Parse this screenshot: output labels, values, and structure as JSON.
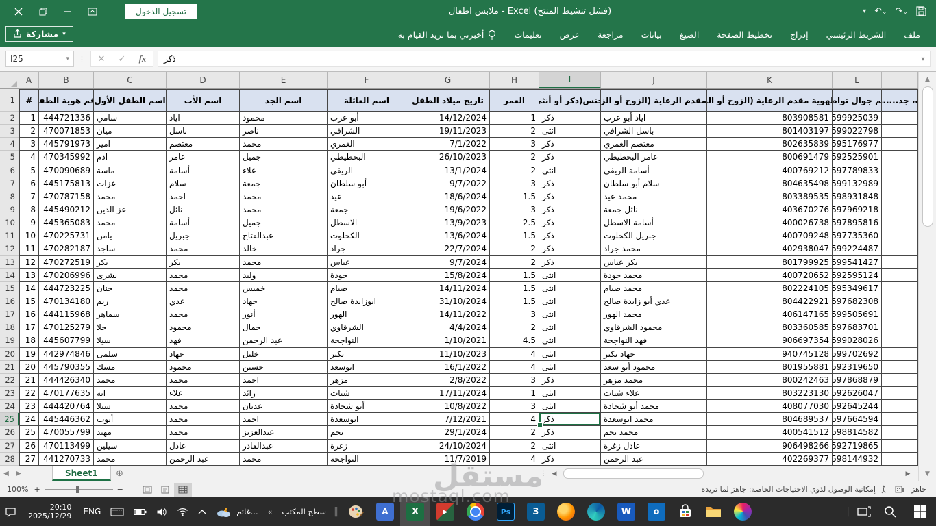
{
  "titlebar": {
    "title": "ملابس اطفال  -  Excel (فشل تنشيط المنتج)",
    "sign_in_label": "تسجيل الدخول"
  },
  "ribbon": {
    "share_label": "مشاركة",
    "tabs": [
      "ملف",
      "الشريط الرئيسي",
      "إدراج",
      "تخطيط الصفحة",
      "الصيغ",
      "بيانات",
      "مراجعة",
      "عرض",
      "تعليمات"
    ],
    "tell_me_label": "أخبرني بما تريد القيام به"
  },
  "formula_bar": {
    "name_box": "I25",
    "value": "ذكر"
  },
  "grid": {
    "column_letters": [
      "A",
      "B",
      "C",
      "D",
      "E",
      "F",
      "G",
      "H",
      "I",
      "J",
      "K",
      "L",
      ""
    ],
    "selected_cell": "I25",
    "selected_row": 25,
    "selected_col_index": 8,
    "headers": [
      "#",
      "رقم هوية الطفل",
      "اسم الطفل الأول",
      "اسم الأب",
      "اسم الجد",
      "اسم العائلة",
      "تاريخ ميلاد الطفل",
      "العمر",
      "الجنس(ذكر أو أنثى)",
      "اسم مقدم الرعاية (الزوج أو الزوجة)",
      "رقم الهوية مقدم الرعاية (الزوج أو الزوجة)",
      "رقم جوال تواصل",
      "ب، جد......)"
    ],
    "rows": [
      [
        "1",
        "444721336",
        "سامي",
        "اياد",
        "محمود",
        "أبو عرب",
        "14/12/2024",
        "1",
        "ذكر",
        "اياد أبو عرب",
        "803908581",
        "599925039"
      ],
      [
        "2",
        "470071853",
        "ميان",
        "باسل",
        "ناصر",
        "الشرافي",
        "19/11/2023",
        "2",
        "انثى",
        "باسل الشرافي",
        "801403197",
        "599022798"
      ],
      [
        "3",
        "445791973",
        "امير",
        "معتصم",
        "محمد",
        "الغمري",
        "7/1/2022",
        "3",
        "ذكر",
        "معتصم الغمري",
        "802635839",
        "595176977"
      ],
      [
        "4",
        "470345992",
        "ادم",
        "عامر",
        "جميل",
        "البحطيطي",
        "26/10/2023",
        "2",
        "ذكر",
        "عامر البحطيطي",
        "800691479",
        "592525901"
      ],
      [
        "5",
        "470090689",
        "ماسة",
        "أسامة",
        "علاء",
        "الريفي",
        "13/1/2024",
        "2",
        "انثى",
        "أسامة الريفي",
        "400769212",
        "597789833"
      ],
      [
        "6",
        "445175813",
        "عزات",
        "سلام",
        "جمعة",
        "أبو سلطان",
        "9/7/2022",
        "3",
        "ذكر",
        "سلام أبو سلطان",
        "804635498",
        "599132989"
      ],
      [
        "7",
        "470787158",
        "محمد",
        "احمد",
        "محمد",
        "عيد",
        "18/6/2024",
        "1.5",
        "ذكر",
        "محمد عيد",
        "803389535",
        "598931848"
      ],
      [
        "8",
        "445490212",
        "عز الدين",
        "نائل",
        "محمد",
        "جمعة",
        "19/6/2022",
        "3",
        "ذكر",
        "نائل جمعة",
        "403670276",
        "597969218"
      ],
      [
        "9",
        "445365083",
        "محمد",
        "أسامة",
        "جميل",
        "الاسطل",
        "13/9/2023",
        "2.5",
        "ذكر",
        "أسامة الاسطل",
        "400026738",
        "597895816"
      ],
      [
        "10",
        "470225731",
        "يامن",
        "جبريل",
        "عبدالفتاح",
        "الكحلوت",
        "13/6/2024",
        "1.5",
        "ذكر",
        "جبريل الكحلوت",
        "400709248",
        "597735360"
      ],
      [
        "11",
        "470282187",
        "ساجد",
        "محمد",
        "خالد",
        "جراد",
        "22/7/2024",
        "2",
        "ذكر",
        "محمد جراد",
        "402938047",
        "599224487"
      ],
      [
        "12",
        "470272519",
        "بكر",
        "بكر",
        "محمد",
        "عباس",
        "9/7/2024",
        "2",
        "ذكر",
        "بكر عباس",
        "801799925",
        "599541427"
      ],
      [
        "13",
        "470206996",
        "بشرى",
        "محمد",
        "وليد",
        "جودة",
        "15/8/2024",
        "1.5",
        "انثى",
        "محمد جودة",
        "400720652",
        "592595124"
      ],
      [
        "14",
        "444723225",
        "حنان",
        "محمد",
        "خميس",
        "صيام",
        "14/11/2024",
        "1.5",
        "انثى",
        "محمد صيام",
        "802224105",
        "595349617"
      ],
      [
        "15",
        "470134180",
        "ريم",
        "عدي",
        "جهاد",
        "ابوزايدة صالح",
        "31/10/2024",
        "1.5",
        "انثى",
        "عدي أبو زايدة صالح",
        "804422921",
        "597682308"
      ],
      [
        "16",
        "444115968",
        "سماهر",
        "محمد",
        "أنور",
        "الهور",
        "14/11/2022",
        "3",
        "انثى",
        "محمد الهور",
        "406147165",
        "599505691"
      ],
      [
        "17",
        "470125279",
        "حلا",
        "محمود",
        "جمال",
        "الشرقاوي",
        "4/4/2024",
        "2",
        "انثى",
        "محمود الشرقاوي",
        "803360585",
        "597683701"
      ],
      [
        "18",
        "445607799",
        "سيلا",
        "فهد",
        "عبد الرحمن",
        "النواجحة",
        "1/10/2021",
        "4.5",
        "انثى",
        "فهد النواجحة",
        "906697354",
        "599028026"
      ],
      [
        "19",
        "442974846",
        "سلمى",
        "جهاد",
        "خليل",
        "بكير",
        "11/10/2023",
        "4",
        "انثى",
        "جهاد بكير",
        "940745128",
        "599702692"
      ],
      [
        "20",
        "445790355",
        "مسك",
        "محمود",
        "حسين",
        "ابوسعد",
        "16/1/2022",
        "4",
        "انثى",
        "محمود أبو سعد",
        "801955881",
        "592319650"
      ],
      [
        "21",
        "444426340",
        "محمد",
        "محمد",
        "احمد",
        "مزهر",
        "2/8/2022",
        "3",
        "ذكر",
        "محمد مزهر",
        "800242463",
        "597868879"
      ],
      [
        "22",
        "470177635",
        "اية",
        "علاء",
        "رائد",
        "شبات",
        "17/11/2024",
        "1",
        "انثى",
        "علاء شبات",
        "803223130",
        "592626047"
      ],
      [
        "23",
        "444420764",
        "سيلا",
        "محمد",
        "عدنان",
        "أبو شحادة",
        "10/8/2022",
        "3",
        "انثى",
        "محمد أبو شحادة",
        "408077030",
        "592645244"
      ],
      [
        "24",
        "445446362",
        "أيوب",
        "محمد",
        "احمد",
        "ابوسعدة",
        "7/12/2021",
        "4",
        "ذكر",
        "محمد ابوسعدة",
        "804689537",
        "597664594"
      ],
      [
        "25",
        "470055799",
        "مهند",
        "محمد",
        "عبدالعزيز",
        "نجم",
        "29/1/2024",
        "2",
        "ذكر",
        "محمد نجم",
        "400541512",
        "598814582"
      ],
      [
        "26",
        "470113499",
        "سيلين",
        "عادل",
        "عبدالقادر",
        "زغرة",
        "24/10/2024",
        "2",
        "انثى",
        "عادل زغرة",
        "906498266",
        "592719865"
      ],
      [
        "27",
        "441270733",
        "محمد",
        "عبد الرحمن",
        "محمد",
        "النواجحة",
        "11/7/2019",
        "4",
        "ذكر",
        "عبد الرحمن",
        "402269377",
        "598144932"
      ]
    ]
  },
  "sheet_bar": {
    "active_sheet": "Sheet1"
  },
  "status_bar": {
    "ready_label": "جاهز",
    "accessibility_label": "إمكانية الوصول لذوي الاحتياجات الخاصة: جاهز لما تريده",
    "zoom_level": "100%"
  },
  "taskbar": {
    "time": "20:10",
    "date": "2025/12/29",
    "language": "ENG",
    "weather_label": "غائم...",
    "desktop_toolbar_label": "سطح المكتب",
    "icons": [
      "notification-icon",
      "keyboard-icon",
      "battery-icon",
      "speaker-icon",
      "wifi-icon",
      "hidden-icons-chevron",
      "weather-icon",
      "paint-icon",
      "wordpad-icon",
      "excel-icon",
      "media-app-icon",
      "chrome-icon",
      "photoshop-icon",
      "3dsmax-icon",
      "firefox-icon",
      "edge-icon",
      "word-icon",
      "outlook-icon",
      "store-icon",
      "file-explorer-icon",
      "paint3d-icon",
      "task-view-icon",
      "search-icon",
      "start-icon"
    ]
  },
  "watermark": {
    "line1": "مستقل",
    "line2": "mostaql.com"
  }
}
